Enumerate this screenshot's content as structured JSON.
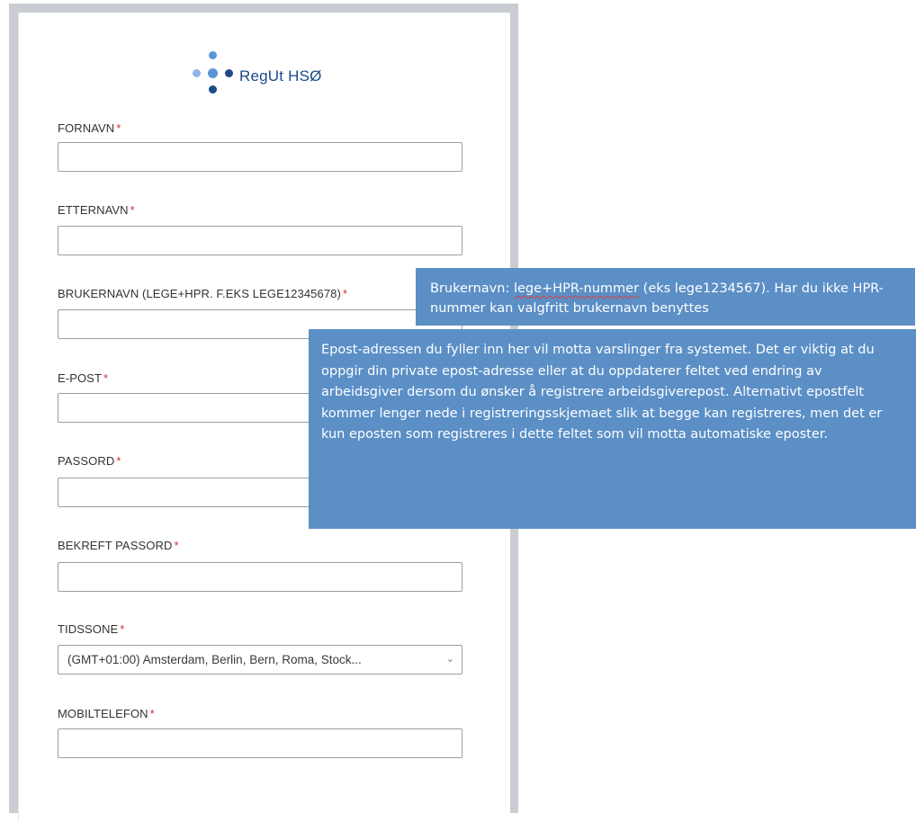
{
  "app": {
    "brand": "RegUt HSØ",
    "accent": "#1c4a8a",
    "logo_light": "#5c95d6",
    "required_color": "#d32f2f",
    "tooltip_bg": "#5b8fc6"
  },
  "form": {
    "required_mark": "*",
    "fields": {
      "fornavn": {
        "label": "FORNAVN",
        "value": ""
      },
      "etternavn": {
        "label": "ETTERNAVN",
        "value": ""
      },
      "brukernavn": {
        "label": "BRUKERNAVN (LEGE+HPR. F.EKS LEGE12345678)",
        "value": ""
      },
      "epost": {
        "label": "E-POST",
        "value": ""
      },
      "passord": {
        "label": "PASSORD",
        "value": ""
      },
      "bekreft": {
        "label": "BEKREFT PASSORD",
        "value": ""
      },
      "tidssone": {
        "label": "TIDSSONE",
        "selected": "(GMT+01:00) Amsterdam, Berlin, Bern, Roma, Stock..."
      },
      "mobil": {
        "label": "MOBILTELEFON",
        "value": ""
      }
    }
  },
  "tooltips": {
    "username": {
      "prefix": "Brukernavn: ",
      "underlined": "lege+HPR-nummer",
      "suffix": " (eks lege1234567). Har du ikke HPR-nummer kan valgfritt brukernavn benyttes"
    },
    "email": {
      "text": "Epost-adressen du fyller inn her vil motta varslinger fra systemet. Det er viktig at du oppgir din private epost-adresse eller at du oppdaterer feltet ved endring av arbeidsgiver dersom du ønsker å registrere arbeidsgiverepost. Alternativt epostfelt kommer lenger nede i registreringsskjemaet slik at begge kan registreres, men det er kun eposten som registreres i dette feltet som vil motta automatiske eposter."
    }
  }
}
